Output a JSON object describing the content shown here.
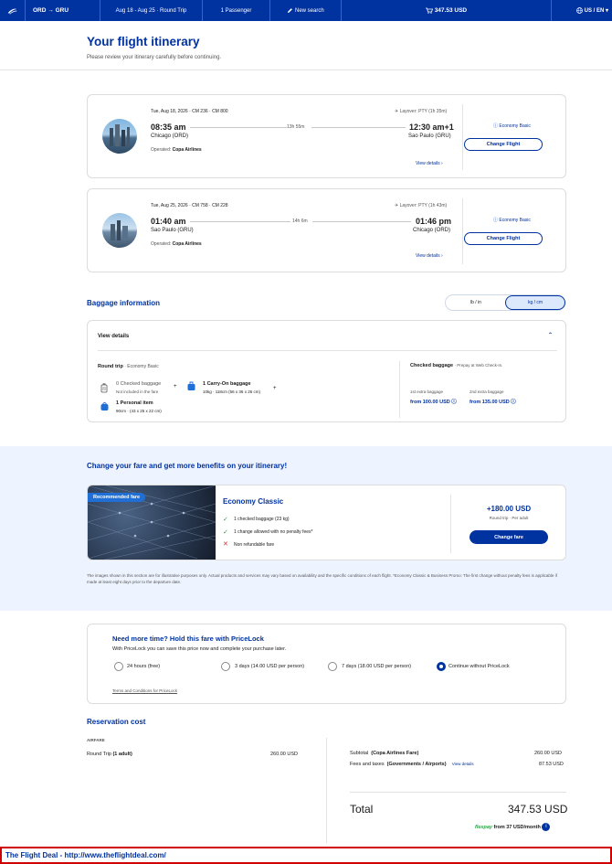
{
  "topbar": {
    "route_from": "ORD",
    "arrow": "→",
    "route_to": "GRU",
    "dates": "Aug 18 - Aug 25 · Round Trip",
    "passengers": "1 Passenger",
    "new_search": "New search",
    "cart_total": "347.53 USD",
    "locale": "US / EN"
  },
  "header": {
    "title": "Your flight itinerary",
    "subtitle": "Please review your itinerary carefully before continuing."
  },
  "flights": [
    {
      "date_line": "Tue, Aug 18, 2026 · CM 236 · CM 800",
      "layover": "Layover: PTY (1h 35m)",
      "dep_time": "08:35 am",
      "dep_city": "Chicago (ORD)",
      "duration": "13h 55m",
      "arr_time": "12:30 am+1",
      "arr_city": "Sao Paulo (GRU)",
      "operated_label": "Operated:",
      "operated_by": "Copa Airlines",
      "view_details": "View details",
      "fare": "Economy Basic",
      "change_button": "Change Flight"
    },
    {
      "date_line": "Tue, Aug 25, 2026 · CM 758 · CM 228",
      "layover": "Layover: PTY (1h 43m)",
      "dep_time": "01:40 am",
      "dep_city": "Sao Paulo (GRU)",
      "duration": "14h 6m",
      "arr_time": "01:46 pm",
      "arr_city": "Chicago (ORD)",
      "operated_label": "Operated:",
      "operated_by": "Copa Airlines",
      "view_details": "View details",
      "fare": "Economy Basic",
      "change_button": "Change Flight"
    }
  ],
  "baggage": {
    "title": "Baggage information",
    "unit_lb": "lb / in",
    "unit_kg": "kg / cm",
    "view_details": "View details",
    "round_trip": "Round trip",
    "fare_note": "· Economy Basic",
    "checked_title": "0 Checked baggage",
    "checked_note": "Not included in the fare",
    "carry_title": "1 Carry-On baggage",
    "carry_note": "10kg · 118cm (56 x 36 x 26 cm)",
    "personal_title": "1 Personal item",
    "personal_note": "90cm · (43 x 25 x 22 cm)",
    "plus": "+",
    "right_title": "Checked baggage",
    "right_note": "· Prepay at Web Check-In.",
    "extra1_label": "1st extra baggage",
    "extra1_value": "from 100.00 USD",
    "extra2_label": "2nd extra baggage",
    "extra2_value": "from 135.00 USD"
  },
  "upsell": {
    "title": "Change your fare and get more benefits on your itinerary!",
    "badge": "Recommended fare",
    "fare_name": "Economy Classic",
    "features": [
      "1 checked baggage (23 kg)",
      "1 change allowed with no penalty fees*",
      "Non refundable fare"
    ],
    "price": "+180.00 USD",
    "price_note": "Round trip · Per adult",
    "button": "Change fare",
    "disclaimer": "The images shown in this section are for illustrative purposes only. Actual products and services may vary based on availability and the specific conditions of each flight. *Economy Classic & Business Promo: The first change without penalty fees is applicable if made at least eight days prior to the departure date."
  },
  "pricelock": {
    "title": "Need more time? Hold this fare with PriceLock",
    "subtitle": "With PriceLock you can save this price now and complete your purchase later.",
    "options": [
      "24 hours (free)",
      "3 days (14.00 USD per person)",
      "7 days (18.00 USD per person)",
      "Continue without PriceLock"
    ],
    "selected_index": 3,
    "terms": "Terms and Conditions for PriceLock"
  },
  "reservation": {
    "title": "Reservation cost",
    "airfare_label": "AIRFARE",
    "round_trip_label": "Round Trip",
    "adult_label": "(1 adult)",
    "round_trip_value": "260.00 USD",
    "subtotal_label": "Subtotal",
    "subtotal_note": "(Copa Airlines Fare)",
    "subtotal_value": "260.00 USD",
    "fees_label": "Fees and taxes",
    "fees_note": "(Governments / Airports)",
    "fees_link": "View details",
    "fees_value": "87.53 USD",
    "total_label": "Total",
    "total_value": "347.53 USD",
    "flexpay_brand": "flexpay",
    "flexpay_text": "from 37 USD/month"
  },
  "footer_banner": "The Flight Deal - http://www.theflightdeal.com/",
  "colors": {
    "brand": "#0032a0",
    "banner_border": "#d00000",
    "upsell_bg": "#eef4ff",
    "flex_green": "#27a844",
    "danger": "#d32f2f"
  }
}
